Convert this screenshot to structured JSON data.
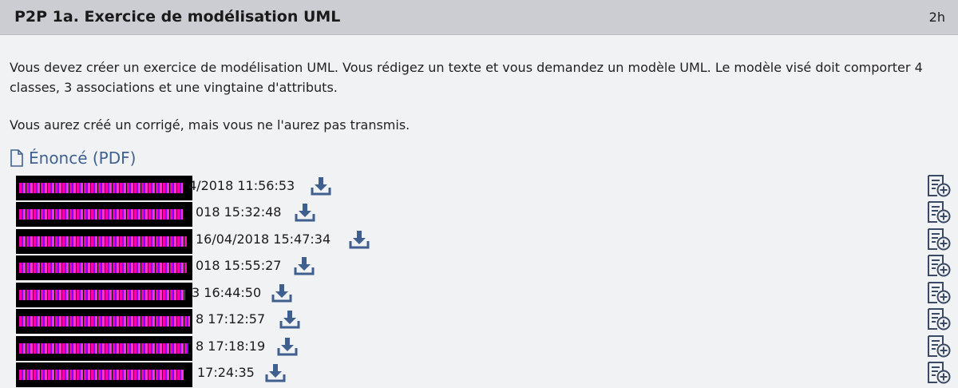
{
  "header": {
    "title": "P2P 1a. Exercice de modélisation UML",
    "duration": "2h"
  },
  "description": {
    "p1": "Vous devez créer un exercice de modélisation UML. Vous rédigez un texte et vous demandez un modèle UML. Le modèle visé doit comporter 4 classes, 3 associations et une vingtaine d'attributs.",
    "p2": "Vous aurez créé un corrigé, mais vous ne l'aurez pas transmis."
  },
  "enonce_link": "Énoncé (PDF)",
  "colors": {
    "link": "#3f6290",
    "header_bg": "#cbcdd3",
    "page_bg": "#f1f2f4"
  },
  "submissions": [
    {
      "timestamp": "4/2018 11:56:53"
    },
    {
      "timestamp": "018 15:32:48"
    },
    {
      "timestamp": "16/04/2018 15:47:34"
    },
    {
      "timestamp": "018 15:55:27"
    },
    {
      "timestamp": "3 16:44:50"
    },
    {
      "timestamp": "8 17:12:57"
    },
    {
      "timestamp": "8 17:18:19"
    },
    {
      "timestamp": "17:24:35"
    }
  ]
}
